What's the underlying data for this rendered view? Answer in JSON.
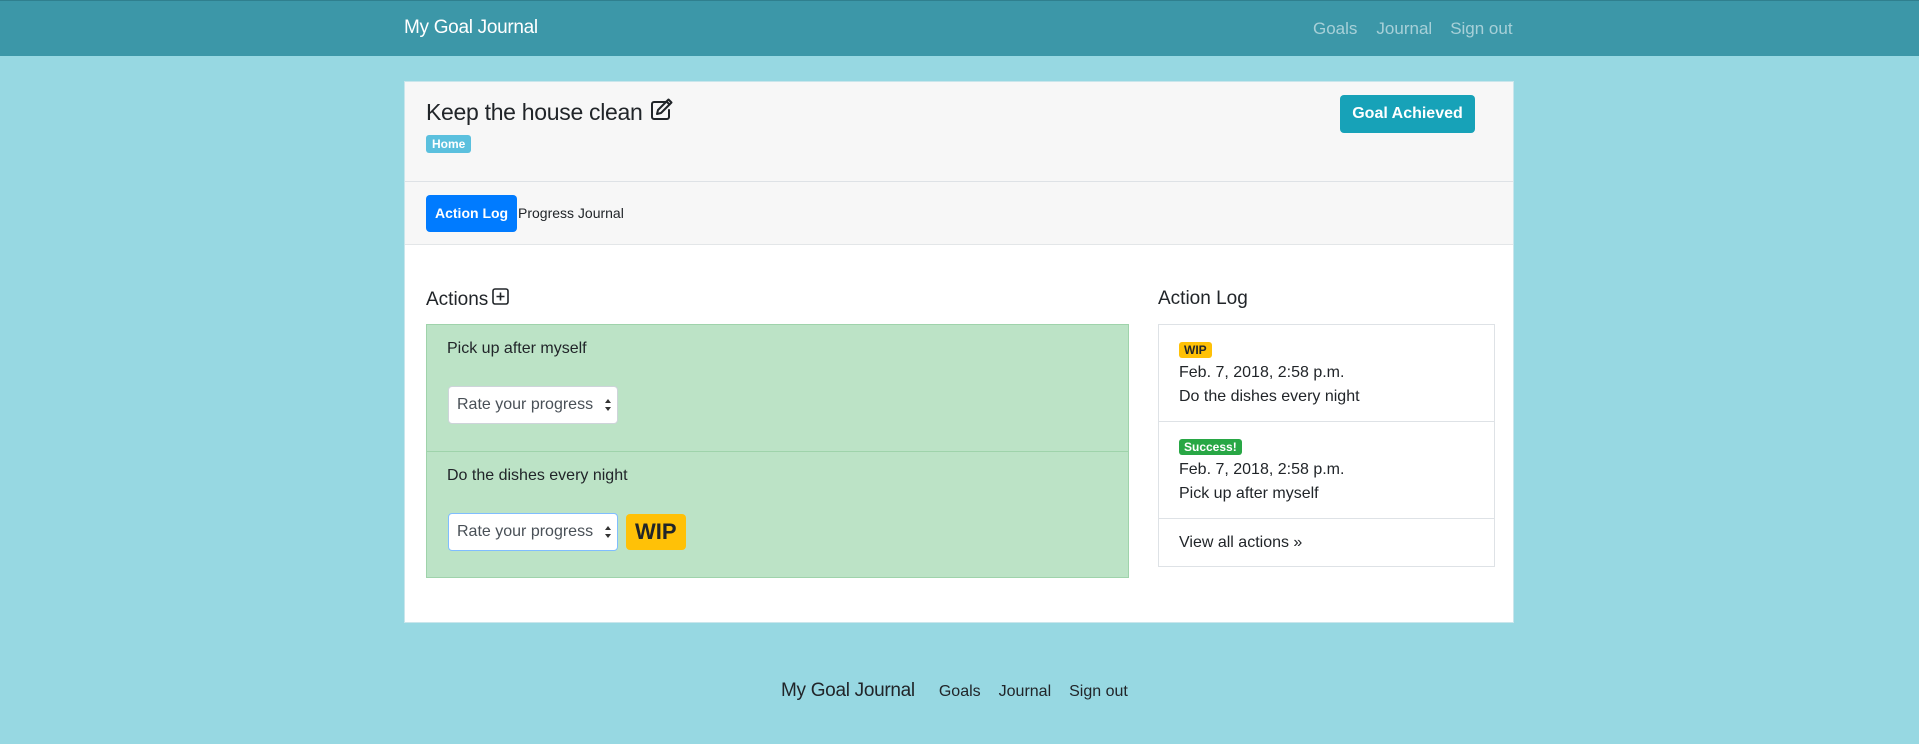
{
  "navbar": {
    "brand": "My Goal Journal",
    "links": [
      "Goals",
      "Journal",
      "Sign out"
    ]
  },
  "goal": {
    "title": "Keep the house clean",
    "category": "Home",
    "achieved_button": "Goal Achieved"
  },
  "tabs": [
    {
      "label": "Action Log",
      "active": true
    },
    {
      "label": "Progress Journal",
      "active": false
    }
  ],
  "actions": {
    "title": "Actions",
    "items": [
      {
        "name": "Pick up after myself",
        "select_value": "Rate your progress",
        "badge": ""
      },
      {
        "name": "Do the dishes every night",
        "select_value": "Rate your progress",
        "badge": "WIP"
      }
    ]
  },
  "action_log": {
    "title": "Action Log",
    "entries": [
      {
        "badge": "WIP",
        "date": "Feb. 7, 2018, 2:58 p.m.",
        "action": "Do the dishes every night"
      },
      {
        "badge": "Success!",
        "date": "Feb. 7, 2018, 2:58 p.m.",
        "action": "Pick up after myself"
      }
    ],
    "view_all": "View all actions »"
  },
  "footer": {
    "brand": "My Goal Journal",
    "links": [
      "Goals",
      "Journal",
      "Sign out"
    ]
  },
  "colors": {
    "background": "#97d8e2",
    "navbar": "#3c97a8",
    "achieved_button": "#17a2b8",
    "active_tab": "#007bff",
    "actions_box": "#bce3c6",
    "wip": "#ffc107",
    "success": "#28a745",
    "category_badge": "#5bc0de"
  },
  "icons": {
    "edit": "pencil-square-icon",
    "add": "plus-square-icon"
  }
}
